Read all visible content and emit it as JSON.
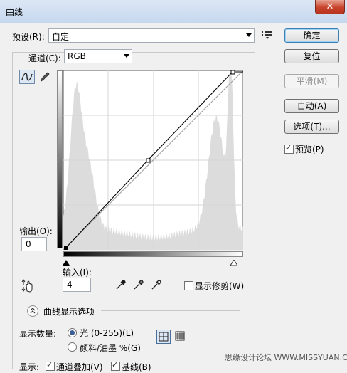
{
  "window": {
    "title": "曲线",
    "close_glyph": "✕"
  },
  "preset": {
    "label": "预设(R):",
    "value": "自定"
  },
  "channel": {
    "label": "通道(C):",
    "value": "RGB"
  },
  "buttons": {
    "ok": "确定",
    "reset": "复位",
    "smooth": "平滑(M)",
    "auto": "自动(A)",
    "options": "选项(T)..."
  },
  "preview": {
    "label": "预览(P)",
    "checked": true
  },
  "output": {
    "label": "输出(O):",
    "value": "0"
  },
  "input": {
    "label": "输入(I):",
    "value": "4"
  },
  "show_clipping": {
    "label": "显示修剪(W)",
    "checked": false
  },
  "curve_options": {
    "label": "曲线显示选项"
  },
  "display_amount": {
    "label": "显示数量:",
    "light": "光 (0-255)(L)",
    "pigment": "颜料/油墨 %(G)",
    "selected": "light"
  },
  "show": {
    "label": "显示:",
    "channel_overlay": "通道叠加(V)",
    "baseline": "基线(B)"
  },
  "watermark": {
    "text": "思缘设计论坛 WWW.MISSYUAN.COM"
  },
  "icons": [
    "curve-point-tool-icon",
    "pencil-icon",
    "menu-icon",
    "hand-adjust-icon",
    "black-eyedropper-icon",
    "gray-eyedropper-icon",
    "white-eyedropper-icon",
    "expand-chevron-icon",
    "grid-coarse-icon",
    "grid-fine-icon"
  ],
  "colors": {
    "histogram": "#dcdcdc",
    "grid": "#d6d6d6",
    "default_button_border": "#3c7fb1"
  }
}
